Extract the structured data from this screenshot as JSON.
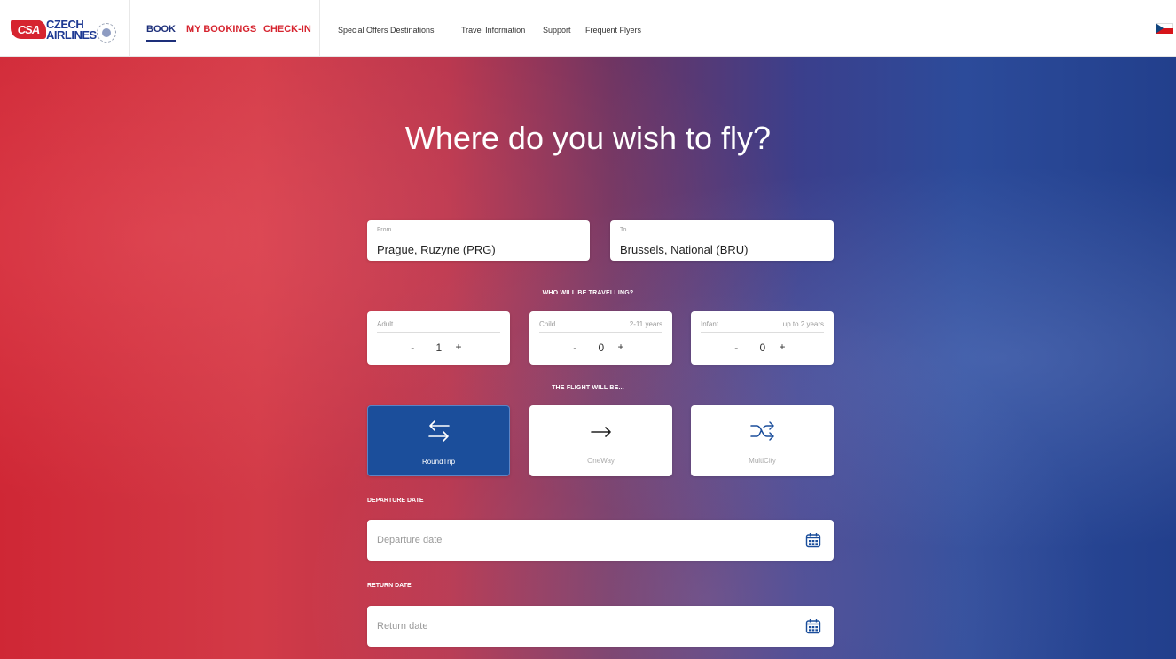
{
  "header": {
    "logo": {
      "mark_text": "CSA",
      "text_line1": "CZECH",
      "text_line2": "AIRLINES"
    },
    "main_nav": {
      "book": "BOOK",
      "my_bookings": "MY BOOKINGS",
      "check_in": "CHECK-IN"
    },
    "sub_nav": {
      "special_offers": "Special Offers",
      "destinations": "Destinations",
      "travel_information": "Travel Information",
      "support": "Support",
      "frequent_flyers": "Frequent Flyers"
    },
    "language_flag": "czech-flag-icon"
  },
  "hero": {
    "title": "Where do you wish to fly?"
  },
  "search": {
    "from": {
      "label": "From",
      "value": "Prague, Ruzyne (PRG)"
    },
    "to": {
      "label": "To",
      "value": "Brussels, National (BRU)"
    },
    "passengers_title": "WHO WILL BE TRAVELLING?",
    "passengers": {
      "adult": {
        "label": "Adult",
        "note": "",
        "count": "1"
      },
      "child": {
        "label": "Child",
        "note": "2-11 years",
        "count": "0"
      },
      "infant": {
        "label": "Infant",
        "note": "up to 2 years",
        "count": "0"
      }
    },
    "stepper": {
      "minus": "-",
      "plus": "+"
    },
    "flight_type_title": "THE FLIGHT WILL BE...",
    "flight_types": {
      "round_trip": "RoundTrip",
      "one_way": "OneWay",
      "multi_city": "MultiCity"
    },
    "selected_flight_type": "round_trip",
    "departure": {
      "title": "DEPARTURE DATE",
      "placeholder": "Departure date"
    },
    "return": {
      "title": "RETURN DATE",
      "placeholder": "Return date"
    }
  },
  "colors": {
    "brand_red": "#d6242f",
    "brand_blue": "#1d2f7a",
    "selected_option": "#1b4e9b"
  }
}
